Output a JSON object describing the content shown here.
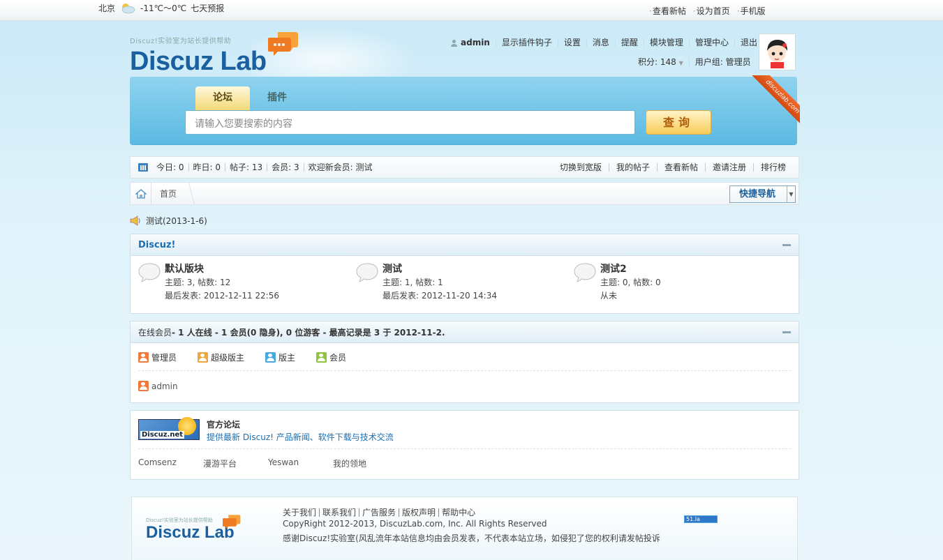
{
  "topbar": {
    "city": "北京",
    "temperature": "-11℃～0℃",
    "forecast": "七天预报",
    "links": [
      "查看新帖",
      "设为首页",
      "手机版"
    ]
  },
  "logo": {
    "tagline": "Discuz!实验室为站长提供帮助",
    "name": "Discuz Lab"
  },
  "user": {
    "name": "admin",
    "nav": [
      "显示插件钩子",
      "设置",
      "消息",
      "提醒",
      "模块管理",
      "管理中心",
      "退出"
    ],
    "credits": "积分: 148",
    "group": "用户组: 管理员"
  },
  "search": {
    "tabs": [
      "论坛",
      "插件"
    ],
    "placeholder": "请输入您要搜索的内容",
    "button": "查询"
  },
  "ribbon": "discuzlab.com",
  "stats": {
    "items": [
      "今日: 0",
      "昨日: 0",
      "帖子: 13",
      "会员: 3",
      "欢迎新会员:  测试"
    ],
    "links": [
      "切换到宽版",
      "我的帖子",
      "查看新帖",
      "邀请注册",
      "排行榜"
    ]
  },
  "breadcrumb": {
    "current": "首页",
    "quicknav": "快捷导航"
  },
  "announcement": "测试(2013-1-6)",
  "category": {
    "title": "Discuz!",
    "forums": [
      {
        "name": "默认版块",
        "stats": "主题: 3, 帖数: 12",
        "last": "最后发表: 2012-12-11 22:56"
      },
      {
        "name": "测试",
        "stats": "主题: 1, 帖数: 1",
        "last": "最后发表: 2012-11-20 14:34"
      },
      {
        "name": "测试2",
        "stats": "主题: 0, 帖数: 0",
        "last": "从未"
      }
    ]
  },
  "online": {
    "label": "在线会员",
    "summary": " - 1 人在线  - 1 会员(0 隐身), 0 位游客  - 最高记录是  3 于  2012-11-2.",
    "legend": [
      {
        "label": "管理员",
        "color": "#f07a3a"
      },
      {
        "label": "超级版主",
        "color": "#f0a640"
      },
      {
        "label": "版主",
        "color": "#48a9e0"
      },
      {
        "label": "会员",
        "color": "#8cc63f"
      }
    ],
    "users": [
      "admin"
    ]
  },
  "friendlinks": {
    "official_title": "官方论坛",
    "official_desc": "提供最新  Discuz! 产品新闻、软件下载与技术交流",
    "badge": "Discuz.net",
    "partners": [
      "Comsenz",
      "漫游平台",
      "Yeswan",
      "我的领地"
    ]
  },
  "footer": {
    "links": [
      "关于我们",
      "联系我们",
      "广告服务",
      "版权声明",
      "帮助中心"
    ],
    "copyright": "CopyRight 2012-2013, DiscuzLab.com, Inc. All Rights Reserved",
    "thanks": "感谢Discuz!实验室(风乱流年本站信息均由会员发表，不代表本站立场，如侵犯了您的权利请发帖投诉",
    "counter": "51.la"
  },
  "colors": {
    "accent": "#1a6fb4",
    "search_bg": "#5bb9e2",
    "button": "#f7cc59"
  }
}
